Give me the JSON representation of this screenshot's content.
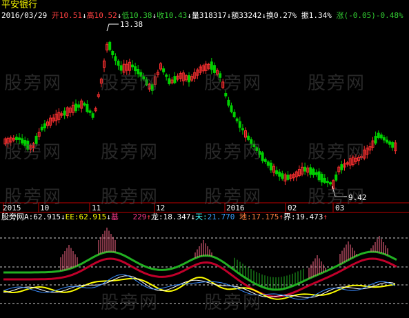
{
  "stock": {
    "name": "平安银行"
  },
  "quote": {
    "date": "2016/03/29",
    "open_label": "开",
    "open": "10.51",
    "open_arrow": "↓",
    "high_label": "高",
    "high": "10.52",
    "high_arrow": "↓",
    "low_label": "低",
    "low": "10.38",
    "low_arrow": "↓",
    "close_label": "收",
    "close": "10.43",
    "close_arrow": "↓",
    "volume_label": "量",
    "volume": "318317",
    "volume_arrow": "↓",
    "amount_label": "额",
    "amount": "33242",
    "amount_arrow": "↓",
    "turnover_label": "换",
    "turnover": "0.27%",
    "amplitude_label": "振",
    "amplitude": "1.34%",
    "change_label": "涨",
    "change": "(-0.05)-0.48%"
  },
  "price_markers": {
    "high": "13.38",
    "low": "9.42"
  },
  "time_axis": {
    "labels": [
      "2015",
      "10",
      "11",
      "12",
      "2016",
      "02",
      "03"
    ]
  },
  "indicator": {
    "name": "股旁网",
    "a_label": "A:",
    "a_value": "62.915",
    "a_arrow": "↓",
    "ee_label": "EE:",
    "ee_value": "62.915",
    "ee_arrow": "↓",
    "x_label": "基",
    "x_value": "229",
    "x_arrow": "↑",
    "long_label": "龙:",
    "long_value": "18.347",
    "long_arrow": "↓",
    "tian_label": "天:",
    "tian_value": "21.770",
    "di_label": "地:",
    "di_value": "17.175",
    "di_arrow": "↑",
    "jie_label": "界:",
    "jie_value": "19.473",
    "jie_arrow": "↑"
  },
  "watermark": "股旁网",
  "colors": {
    "up": "#ff3030",
    "down": "#00d000",
    "background": "#000000",
    "axis": "#c00000"
  },
  "chart_data": {
    "type": "candlestick",
    "high": 13.38,
    "low": 9.42,
    "ylim": [
      9.1,
      13.6
    ],
    "x_ticks": [
      "2015",
      "10",
      "11",
      "12",
      "2016",
      "02",
      "03"
    ]
  }
}
